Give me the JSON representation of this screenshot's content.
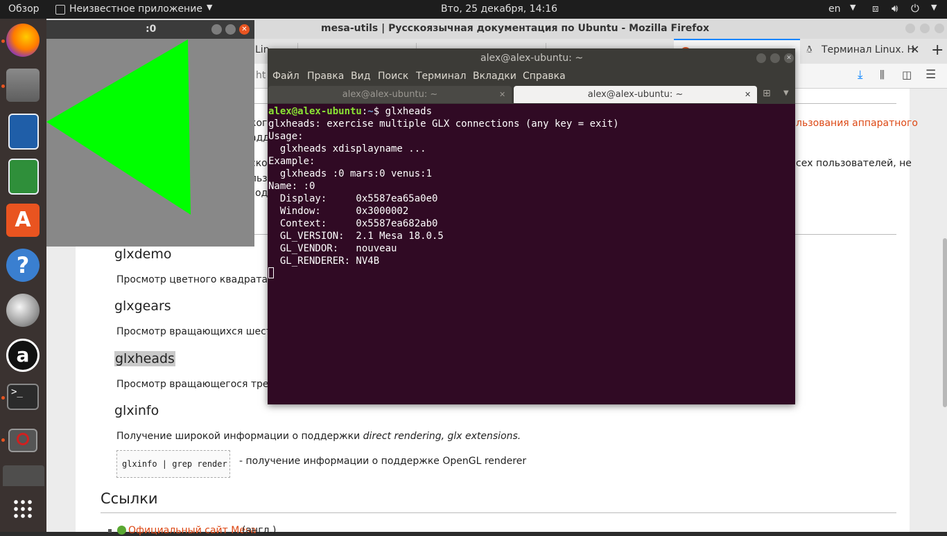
{
  "topbar": {
    "overview": "Обзор",
    "app_menu": "Неизвестное приложение",
    "clock": "Вто, 25 декабря, 14:16",
    "lang": "en"
  },
  "firefox": {
    "title": "mesa-utils | Русскоязычная документация по Ubuntu - Mozilla Firefox",
    "tabs": [
      "Lin",
      "",
      "",
      "",
      "",
      "Терминал Linux. Н"
    ],
    "url_fragment": "ht",
    "content": {
      "text_top_right": "льзования аппаратного",
      "text_mid_right": "сех пользователей, не",
      "frag1": "ког",
      "frag2": "адд",
      "frag3": "ско",
      "frag4": "льз",
      "frag5": "од",
      "h_glxdemo": "glxdemo",
      "p_glxdemo": "Просмотр цветного квадрата для",
      "h_glxgears": "glxgears",
      "p_glxgears": "Просмотр вращающихся шестер",
      "h_glxheads": "glxheads",
      "p_glxheads": "Просмотр вращающегося треугол",
      "h_glxinfo": "glxinfo",
      "p_glxinfo_a": "Получение широкой информации о поддержки ",
      "p_glxinfo_b": "direct rendering, glx extensions.",
      "code_glxinfo": "glxinfo | grep render",
      "p_code_desc": "- получение информации о поддержке OpenGL renderer",
      "h_links": "Ссылки",
      "link_official": "Официальный сайт Mesa",
      "link_suffix": "(англ.)"
    }
  },
  "glx_window": {
    "title": ":0"
  },
  "terminal": {
    "title": "alex@alex-ubuntu: ~",
    "menu": [
      "Файл",
      "Правка",
      "Вид",
      "Поиск",
      "Терминал",
      "Вкладки",
      "Справка"
    ],
    "tabs": [
      "alex@alex-ubuntu: ~",
      "alex@alex-ubuntu: ~"
    ],
    "prompt_user": "alex@alex-ubuntu",
    "prompt_sep": ":",
    "prompt_path": "~",
    "prompt_cmd": "$ glxheads",
    "output": "glxheads: exercise multiple GLX connections (any key = exit)\nUsage:\n  glxheads xdisplayname ...\nExample:\n  glxheads :0 mars:0 venus:1\nName: :0\n  Display:     0x5587ea65a0e0\n  Window:      0x3000002\n  Context:     0x5587ea682ab0\n  GL_VERSION:  2.1 Mesa 18.0.5\n  GL_VENDOR:   nouveau\n  GL_RENDERER: NV4B"
  },
  "colors": {
    "accent": "#e95420",
    "terminal_bg": "#300a24",
    "triangle": "#00ff00"
  }
}
